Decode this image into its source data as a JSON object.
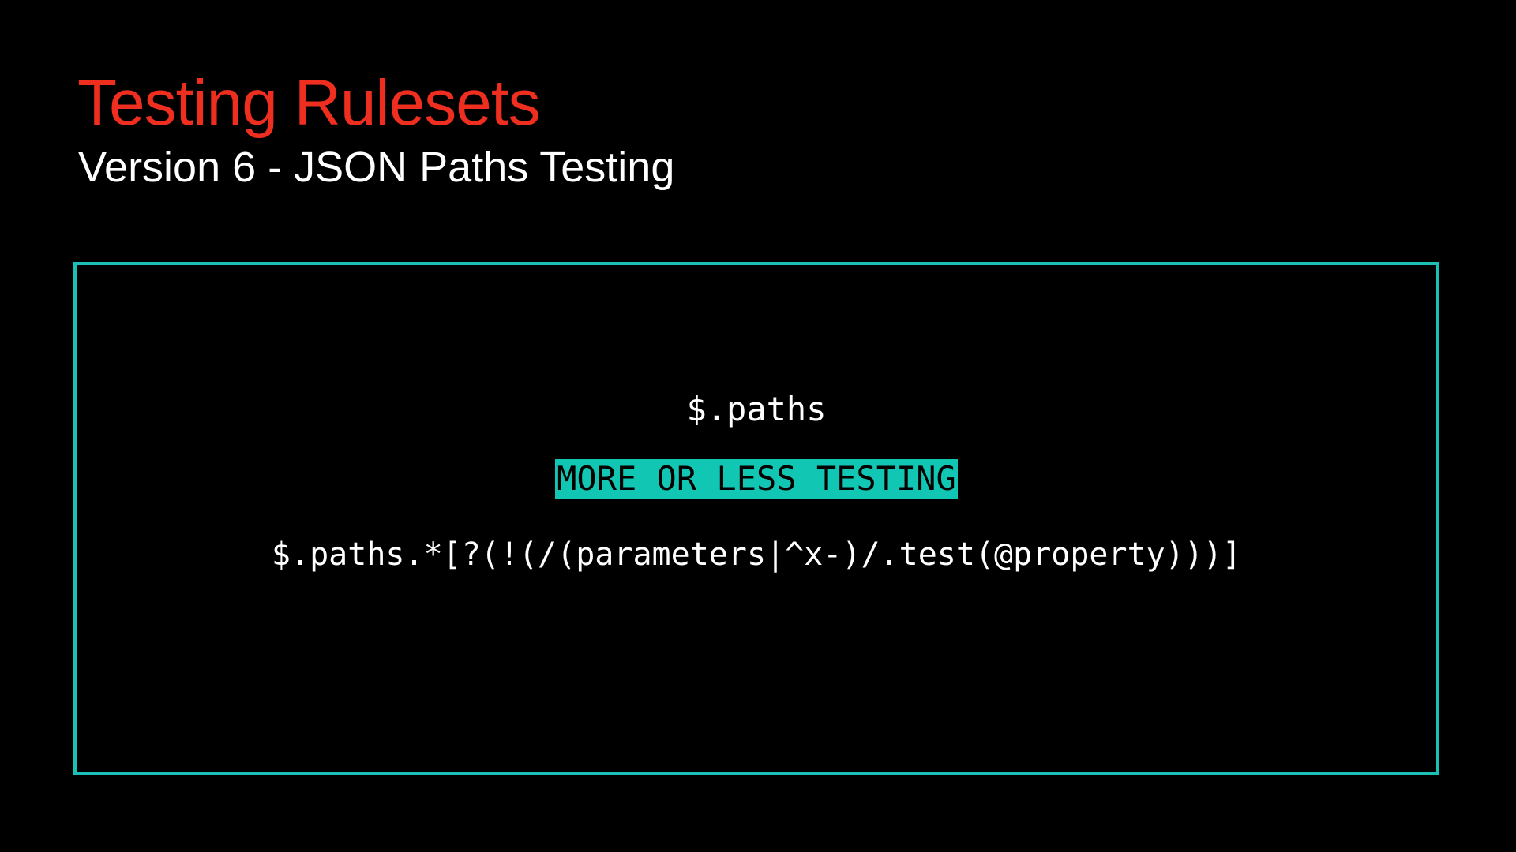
{
  "slide": {
    "title": "Testing Rulesets",
    "subtitle": "Version 6 - JSON Paths Testing"
  },
  "code_box": {
    "line1": "$.paths",
    "highlight_label": "MORE OR LESS TESTING",
    "line3": "$.paths.*[?(!(/(parameters|^x-)/.test(@property)))]"
  },
  "colors": {
    "background": "#000000",
    "title": "#ee2e1f",
    "subtitle": "#ffffff",
    "frame_border": "#1cbfb5",
    "code_text": "#ffffff",
    "highlight_bg": "#12c6b4",
    "highlight_text": "#000000"
  }
}
